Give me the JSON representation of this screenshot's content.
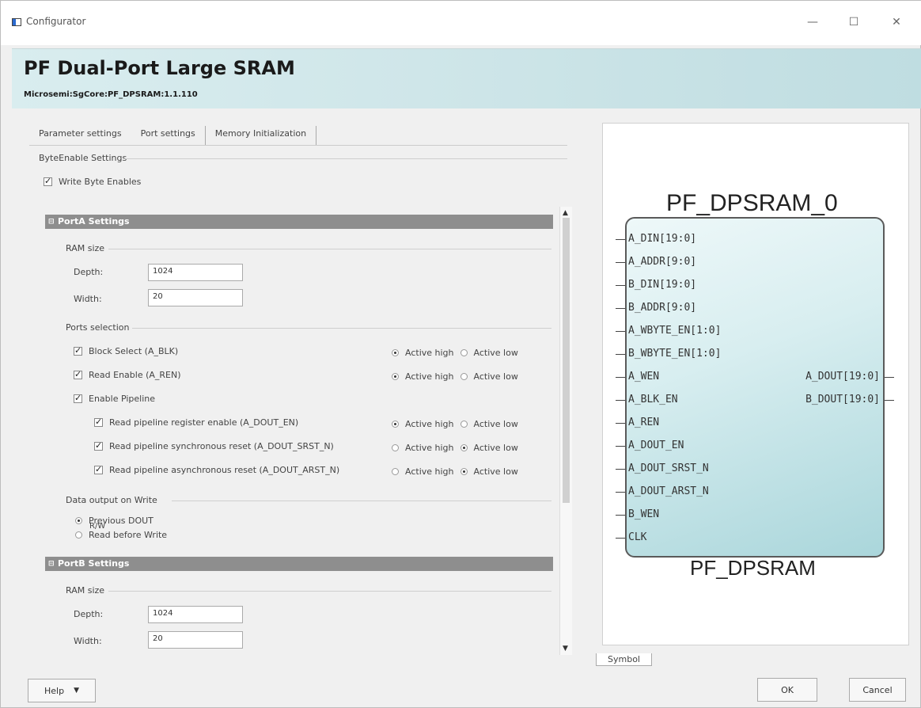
{
  "window": {
    "title": "Configurator",
    "minimize": "—",
    "maximize": "☐",
    "close": "✕"
  },
  "header": {
    "title": "PF Dual-Port Large SRAM",
    "subtitle": "Microsemi:SgCore:PF_DPSRAM:1.1.110"
  },
  "tabs": [
    "Parameter settings",
    "Port settings",
    "Memory Initialization"
  ],
  "byte_enable": {
    "section": "ByteEnable Settings",
    "write_byte_enables": "Write Byte Enables"
  },
  "portA": {
    "group": "PortA Settings",
    "ram_size": "RAM size",
    "depth_label": "Depth:",
    "depth_value": "1024",
    "width_label": "Width:",
    "width_value": "20",
    "ports_selection": "Ports selection",
    "options": [
      {
        "label": "Block Select (A_BLK)",
        "high": "Active high",
        "low": "Active low"
      },
      {
        "label": "Read Enable (A_REN)",
        "high": "Active high",
        "low": "Active low"
      }
    ],
    "enable_pipeline": "Enable Pipeline",
    "pipeline": [
      {
        "label": "Read pipeline register enable (A_DOUT_EN)",
        "high": "Active high",
        "low": "Active low"
      },
      {
        "label": "Read pipeline synchronous reset (A_DOUT_SRST_N)",
        "high": "Active high",
        "low": "Active low"
      },
      {
        "label": "Read pipeline asynchronous reset (A_DOUT_ARST_N)",
        "high": "Active high",
        "low": "Active low"
      }
    ],
    "data_output": "Data output on Write",
    "previous_dout": "Previous DOUT",
    "rw": "R/W",
    "read_before_write": "Read before Write"
  },
  "portB": {
    "group": "PortB Settings",
    "ram_size": "RAM size",
    "depth_label": "Depth:",
    "depth_value": "1024",
    "width_label": "Width:",
    "width_value": "20"
  },
  "symbol": {
    "instance": "PF_DPSRAM_0",
    "component": "PF_DPSRAM",
    "tab": "Symbol",
    "inputs": [
      "A_DIN[19:0]",
      "A_ADDR[9:0]",
      "B_DIN[19:0]",
      "B_ADDR[9:0]",
      "A_WBYTE_EN[1:0]",
      "B_WBYTE_EN[1:0]",
      "A_WEN",
      "A_BLK_EN",
      "A_REN",
      "A_DOUT_EN",
      "A_DOUT_SRST_N",
      "A_DOUT_ARST_N",
      "B_WEN",
      "CLK"
    ],
    "outputs": [
      "A_DOUT[19:0]",
      "B_DOUT[19:0]"
    ]
  },
  "footer": {
    "help": "Help",
    "ok": "OK",
    "cancel": "Cancel"
  }
}
